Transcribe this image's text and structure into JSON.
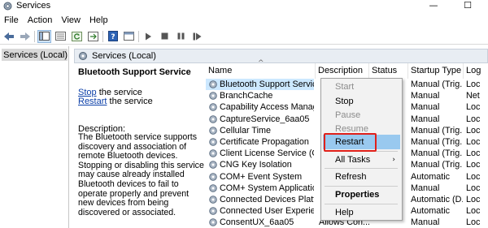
{
  "window": {
    "title": "Services",
    "minimize": "—",
    "maximize": "☐"
  },
  "menu": [
    "File",
    "Action",
    "View",
    "Help"
  ],
  "tree": {
    "item": "Services (Local)"
  },
  "pane_header": "Services (Local)",
  "description": {
    "title": "Bluetooth Support Service",
    "stop_link": "Stop",
    "stop_suffix": " the service",
    "restart_link": "Restart",
    "restart_suffix": " the service",
    "label": "Description:",
    "body": "The Bluetooth service supports discovery and association of remote Bluetooth devices.  Stopping or disabling this service may cause already installed Bluetooth devices to fail to operate properly and prevent new devices from being discovered or associated."
  },
  "columns": {
    "name": "Name",
    "description": "Description",
    "status": "Status",
    "startup": "Startup Type",
    "logon": "Log"
  },
  "rows": [
    {
      "name": "Bluetooth Support Service",
      "description": "",
      "startup": "Manual (Trig...",
      "logon": "Loc",
      "selected": true
    },
    {
      "name": "BranchCache",
      "description": "",
      "startup": "Manual",
      "logon": "Net"
    },
    {
      "name": "Capability Access Manager ...",
      "description": "",
      "startup": "Manual",
      "logon": "Loc"
    },
    {
      "name": "CaptureService_6aa05",
      "description": "",
      "startup": "Manual",
      "logon": "Loc"
    },
    {
      "name": "Cellular Time",
      "description": "",
      "startup": "Manual (Trig...",
      "logon": "Loc"
    },
    {
      "name": "Certificate Propagation",
      "description": "",
      "startup": "Manual (Trig...",
      "logon": "Loc"
    },
    {
      "name": "Client License Service (ClipS...",
      "description": "",
      "startup": "Manual (Trig...",
      "logon": "Loc"
    },
    {
      "name": "CNG Key Isolation",
      "description": "",
      "startup": "Manual (Trig...",
      "logon": "Loc"
    },
    {
      "name": "COM+ Event System",
      "description": "",
      "startup": "Automatic",
      "logon": "Loc"
    },
    {
      "name": "COM+ System Application",
      "description": "",
      "startup": "Manual",
      "logon": "Loc"
    },
    {
      "name": "Connected Devices Platfor...",
      "description": "",
      "startup": "Automatic (D...",
      "logon": "Loc"
    },
    {
      "name": "Connected User Experience...",
      "description": "",
      "startup": "Automatic",
      "logon": "Loc"
    },
    {
      "name": "ConsentUX_6aa05",
      "description": "Allows Con...",
      "startup": "Manual",
      "logon": "Loc"
    }
  ],
  "context_menu": {
    "start": "Start",
    "stop": "Stop",
    "pause": "Pause",
    "resume": "Resume",
    "restart": "Restart",
    "all_tasks": "All Tasks",
    "refresh": "Refresh",
    "properties": "Properties",
    "help": "Help",
    "submenu_arrow": "›"
  },
  "colors": {
    "highlight": "#99c9ef",
    "callout": "#e0201a",
    "link": "#0b3fa8"
  }
}
